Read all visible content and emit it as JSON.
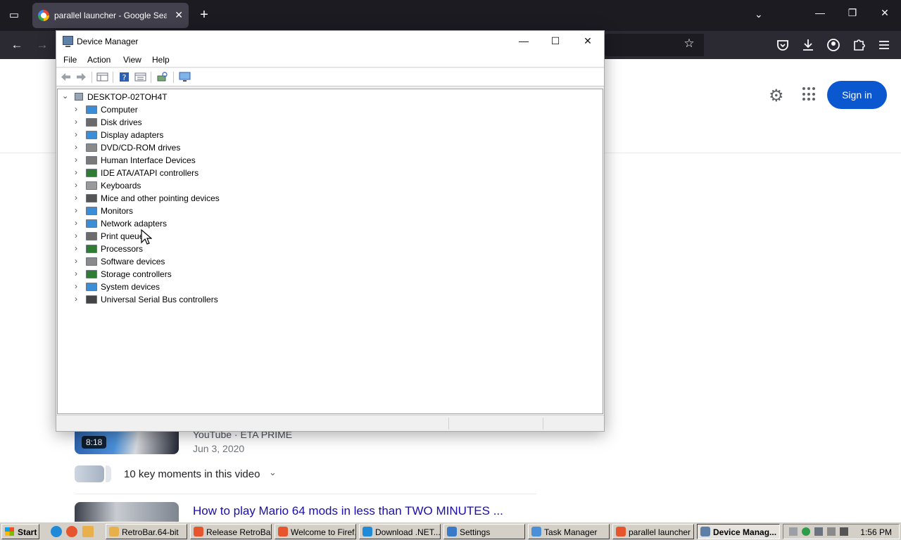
{
  "browser": {
    "tab_title": "parallel launcher - Google Search",
    "tab_close": "✕",
    "new_tab": "+",
    "list_all_tabs": "⌄",
    "window_controls": {
      "minimize": "—",
      "restore": "❐",
      "close": "✕"
    },
    "nav": {
      "back": "←",
      "forward": "→",
      "bookmark_star": "☆"
    }
  },
  "google": {
    "sign_in": "Sign in",
    "result1": {
      "source": "YouTube · ETA PRIME",
      "date": "Jun 3, 2020",
      "duration": "8:18"
    },
    "key_moments": "10 key moments in this video",
    "result2_title": "How to play Mario 64 mods in less than TWO MINUTES ..."
  },
  "device_manager": {
    "title": "Device Manager",
    "menu": [
      "File",
      "Action",
      "View",
      "Help"
    ],
    "root": "DESKTOP-02TOH4T",
    "nodes": [
      {
        "label": "Computer",
        "color": "#3b8ed6"
      },
      {
        "label": "Disk drives",
        "color": "#6b6b6b"
      },
      {
        "label": "Display adapters",
        "color": "#3b8ed6"
      },
      {
        "label": "DVD/CD-ROM drives",
        "color": "#8a8a8a"
      },
      {
        "label": "Human Interface Devices",
        "color": "#7a7a7a"
      },
      {
        "label": "IDE ATA/ATAPI controllers",
        "color": "#2e7d32"
      },
      {
        "label": "Keyboards",
        "color": "#9a9a9a"
      },
      {
        "label": "Mice and other pointing devices",
        "color": "#555555"
      },
      {
        "label": "Monitors",
        "color": "#3b8ed6"
      },
      {
        "label": "Network adapters",
        "color": "#3b8ed6"
      },
      {
        "label": "Print queues",
        "color": "#6b6b6b"
      },
      {
        "label": "Processors",
        "color": "#2e7d32"
      },
      {
        "label": "Software devices",
        "color": "#8a8a8a"
      },
      {
        "label": "Storage controllers",
        "color": "#2e7d32"
      },
      {
        "label": "System devices",
        "color": "#3b8ed6"
      },
      {
        "label": "Universal Serial Bus controllers",
        "color": "#444444"
      }
    ]
  },
  "taskbar": {
    "start": "Start",
    "tasks": [
      {
        "label": "RetroBar.64-bit",
        "icon_color": "#e8b04a",
        "active": false
      },
      {
        "label": "Release RetroBa...",
        "icon_color": "#e6552e",
        "active": false
      },
      {
        "label": "Welcome to Firef...",
        "icon_color": "#e6552e",
        "active": false
      },
      {
        "label": "Download .NET...",
        "icon_color": "#1f8ad8",
        "active": false
      },
      {
        "label": "Settings",
        "icon_color": "#3a78c8",
        "active": false
      },
      {
        "label": "Task Manager",
        "icon_color": "#4a8fd8",
        "active": false
      },
      {
        "label": "parallel launcher -...",
        "icon_color": "#e6552e",
        "active": false
      },
      {
        "label": "Device Manag...",
        "icon_color": "#5e7fa6",
        "active": true
      }
    ],
    "clock": "1:56 PM"
  }
}
